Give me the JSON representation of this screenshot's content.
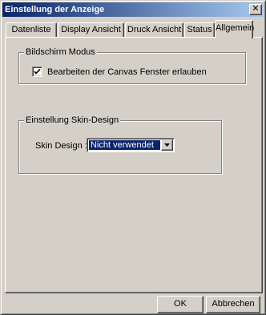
{
  "window": {
    "title": "Einstellung der Anzeige",
    "close_glyph": "✕"
  },
  "tabs": [
    {
      "label": "Datenliste",
      "active": false
    },
    {
      "label": "Display Ansicht",
      "active": false
    },
    {
      "label": "Druck Ansicht",
      "active": false
    },
    {
      "label": "Status",
      "active": false
    },
    {
      "label": "Allgemein",
      "active": true
    }
  ],
  "screen_mode": {
    "group_label": "Bildschirm Modus",
    "edit_canvas_checkbox": {
      "label": "Bearbeiten der Canvas Fenster erlauben",
      "checked": true
    }
  },
  "skin": {
    "group_label": "Einstellung Skin-Design",
    "field_label": "Skin Design :",
    "selected_value": "Nicht verwendet",
    "arrow_icon": "chevron-down-icon"
  },
  "buttons": {
    "ok_label": "OK",
    "cancel_label": "Abbrechen"
  },
  "colors": {
    "dialog_face": "#d4d0c8",
    "title_gradient_start": "#0a246a",
    "title_gradient_end": "#a6caf0",
    "selection_highlight": "#0a246a"
  }
}
